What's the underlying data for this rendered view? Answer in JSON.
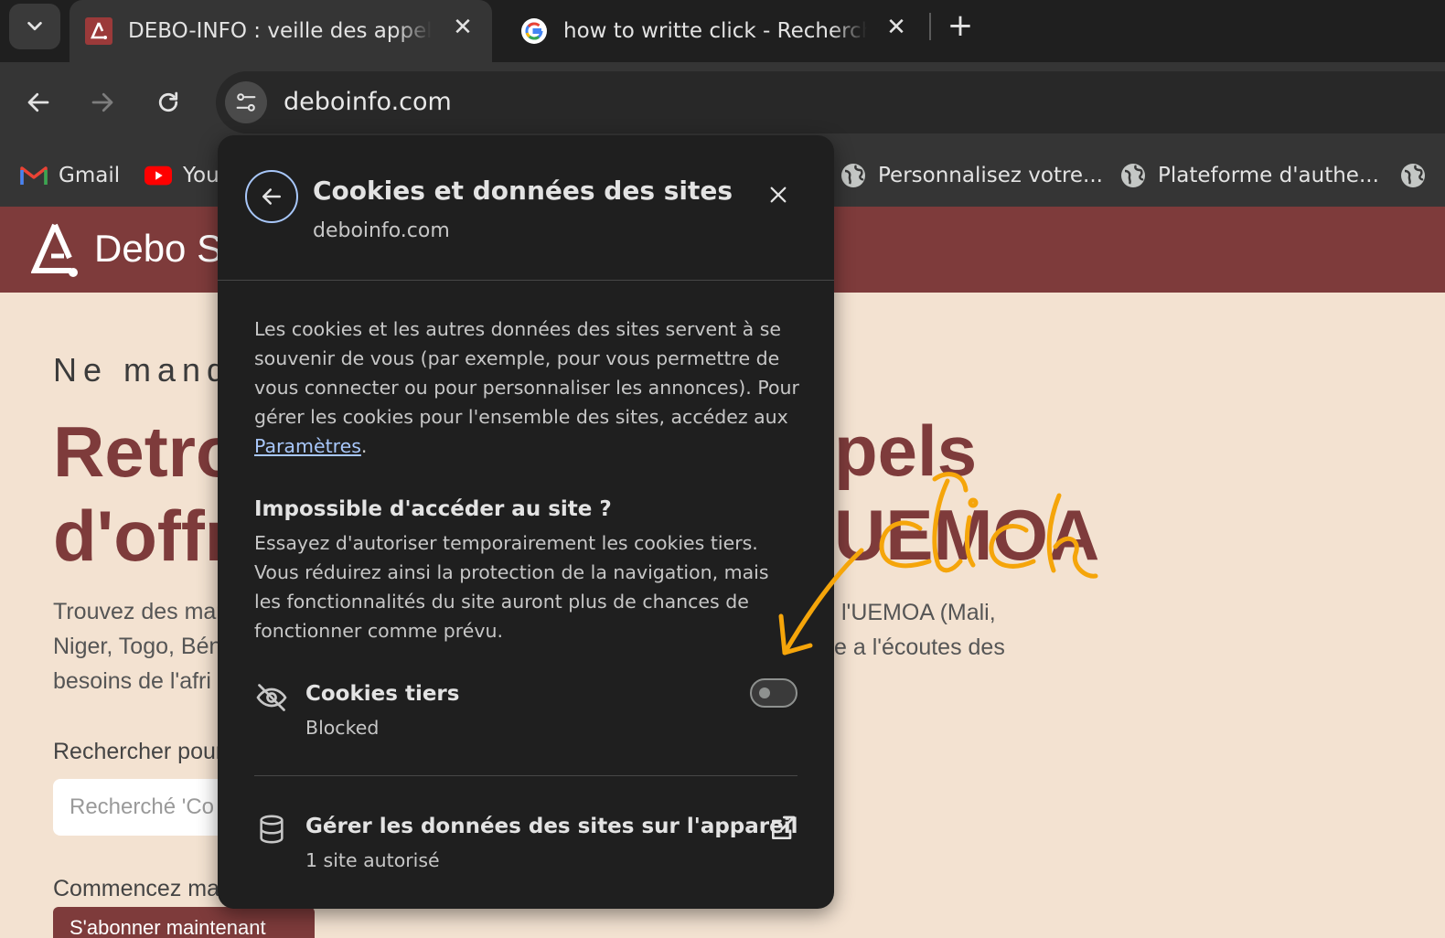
{
  "browser": {
    "tabs": [
      {
        "title": "DEBO-INFO : veille des appels d’offres",
        "active": true
      },
      {
        "title": "how to writte click - Recherche Google",
        "active": false
      }
    ],
    "url": "deboinfo.com",
    "bookmarks": [
      {
        "label": "Gmail"
      },
      {
        "label": "YouTube"
      },
      {
        "label": "Personnalisez votre..."
      },
      {
        "label": "Plateforme d'authe..."
      }
    ]
  },
  "page": {
    "brand": "Debo Solutions",
    "kicker": "Ne manquez",
    "hero_line1_left": "Retro",
    "hero_line1_right": "pels",
    "hero_line2_left": "d'offr",
    "hero_line2_right": "UEMOA",
    "desc_line1_left": "Trouvez des mar",
    "desc_line1_right": "l'UEMOA (Mali,",
    "desc_line2_left": "Niger, Togo, Bén",
    "desc_line2_right": "e a l'écoutes des",
    "desc_line3_left": "besoins de l'afri",
    "search_label": "Rechercher pour",
    "search_placeholder": "Recherché 'Co",
    "start_label": "Commencez ma",
    "subscribe_button": "S'abonner maintenant"
  },
  "popup": {
    "title": "Cookies et données des sites",
    "site": "deboinfo.com",
    "intro": "Les cookies et les autres données des sites servent à se souvenir de vous (par exemple, pour vous permettre de vous connecter ou pour personnaliser les annonces). Pour gérer les cookies pour l'ensemble des sites, accédez aux",
    "settings_link": "Paramètres",
    "access_heading": "Impossible d'accéder au site ?",
    "access_text": "Essayez d'autoriser temporairement les cookies tiers. Vous réduirez ainsi la protection de la navigation, mais les fonctionnalités du site auront plus de chances de fonctionner comme prévu.",
    "third_party_title": "Cookies tiers",
    "third_party_status": "Blocked",
    "third_party_enabled": false,
    "manage_title": "Gérer les données des sites sur l'appareil",
    "manage_sub": "1 site autorisé"
  },
  "annotation": {
    "text": "click",
    "color": "#f5a50a"
  },
  "icons": {
    "tab_menu": "chevron-down-icon",
    "back": "arrow-left-icon",
    "forward": "arrow-right-icon",
    "reload": "reload-icon",
    "site_info": "tune-icon",
    "third_party": "eye-off-icon",
    "manage": "database-icon",
    "external": "open-in-new-icon"
  }
}
